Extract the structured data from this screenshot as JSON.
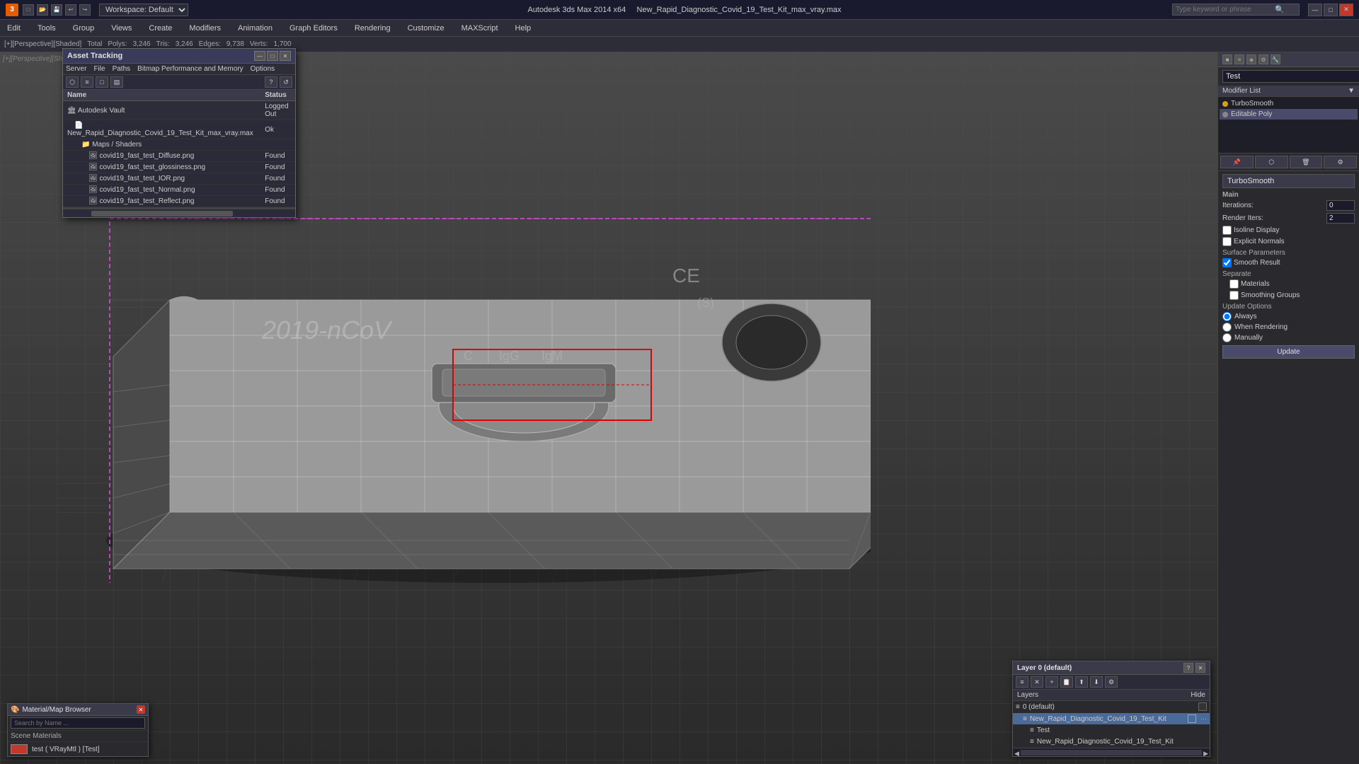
{
  "titlebar": {
    "app_title": "Autodesk 3ds Max 2014 x64",
    "file_name": "New_Rapid_Diagnostic_Covid_19_Test_Kit_max_vray.max",
    "workspace_label": "Workspace: Default",
    "search_placeholder": "Type keyword or phrase",
    "minimize": "—",
    "maximize": "□",
    "close": "✕"
  },
  "menubar": {
    "items": [
      "Edit",
      "Tools",
      "Group",
      "Views",
      "Create",
      "Modifiers",
      "Animation",
      "Graph Editors",
      "Rendering",
      "Customize",
      "MAXScript",
      "Help"
    ]
  },
  "statusbar": {
    "viewport_label": "[+][Perspective][Shaded]",
    "stats": {
      "total_label": "Total",
      "polys_label": "Polys:",
      "polys_value": "3,246",
      "tris_label": "Tris:",
      "tris_value": "3,246",
      "edges_label": "Edges:",
      "edges_value": "9,738",
      "verts_label": "Verts:",
      "verts_value": "1,700"
    }
  },
  "asset_tracking": {
    "title": "Asset Tracking",
    "menu_items": [
      "Server",
      "File",
      "Paths",
      "Bitmap Performance and Memory",
      "Options"
    ],
    "columns": {
      "name": "Name",
      "status": "Status"
    },
    "rows": [
      {
        "indent": 0,
        "icon": "vault",
        "name": "Autodesk Vault",
        "status": "Logged Out"
      },
      {
        "indent": 1,
        "icon": "file",
        "name": "New_Rapid_Diagnostic_Covid_19_Test_Kit_max_vray.max",
        "status": "Ok"
      },
      {
        "indent": 2,
        "icon": "folder",
        "name": "Maps / Shaders",
        "status": ""
      },
      {
        "indent": 3,
        "icon": "image",
        "name": "covid19_fast_test_Diffuse.png",
        "status": "Found"
      },
      {
        "indent": 3,
        "icon": "image",
        "name": "covid19_fast_test_glossiness.png",
        "status": "Found"
      },
      {
        "indent": 3,
        "icon": "image",
        "name": "covid19_fast_test_IOR.png",
        "status": "Found"
      },
      {
        "indent": 3,
        "icon": "image",
        "name": "covid19_fast_test_Normal.png",
        "status": "Found"
      },
      {
        "indent": 3,
        "icon": "image",
        "name": "covid19_fast_test_Reflect.png",
        "status": "Found"
      }
    ]
  },
  "right_panel": {
    "modifier_name": "Test",
    "modifier_list_label": "Modifier List",
    "modifiers": [
      {
        "name": "TurboSmooth",
        "selected": false
      },
      {
        "name": "Editable Poly",
        "selected": true
      }
    ],
    "turbosmooth": {
      "title": "TurboSmooth",
      "main_label": "Main",
      "iterations_label": "Iterations:",
      "iterations_value": "0",
      "render_iters_label": "Render Iters:",
      "render_iters_value": "2",
      "isoline_display_label": "Isoline Display",
      "explicit_normals_label": "Explicit Normals",
      "surface_params_label": "Surface Parameters",
      "smooth_result_label": "Smooth Result",
      "smooth_result_checked": true,
      "separate_label": "Separate",
      "materials_label": "Materials",
      "smoothing_groups_label": "Smoothing Groups",
      "update_options_label": "Update Options",
      "always_label": "Always",
      "when_rendering_label": "When Rendering",
      "manually_label": "Manually",
      "update_button": "Update"
    }
  },
  "material_browser": {
    "title": "Material/Map Browser",
    "search_label": "Search by Name ...",
    "search_placeholder": "Search by Name ...",
    "scene_materials_label": "Scene Materials",
    "materials": [
      {
        "name": "test ( VRayMtl ) [Test]",
        "color": "#c0392b"
      }
    ]
  },
  "layer_panel": {
    "title": "Layer 0 (default)",
    "question_label": "?",
    "close_label": "✕",
    "layers_label": "Layers",
    "hide_label": "Hide",
    "layers": [
      {
        "indent": 0,
        "name": "0 (default)",
        "selected": false
      },
      {
        "indent": 1,
        "name": "New_Rapid_Diagnostic_Covid_19_Test_Kit",
        "selected": true
      },
      {
        "indent": 2,
        "name": "Test",
        "selected": false
      },
      {
        "indent": 2,
        "name": "New_Rapid_Diagnostic_Covid_19_Test_Kit",
        "selected": false
      }
    ]
  },
  "viewport": {
    "label": "[+][Perspective][Shaded]",
    "model_text": "2019-nCoV"
  }
}
